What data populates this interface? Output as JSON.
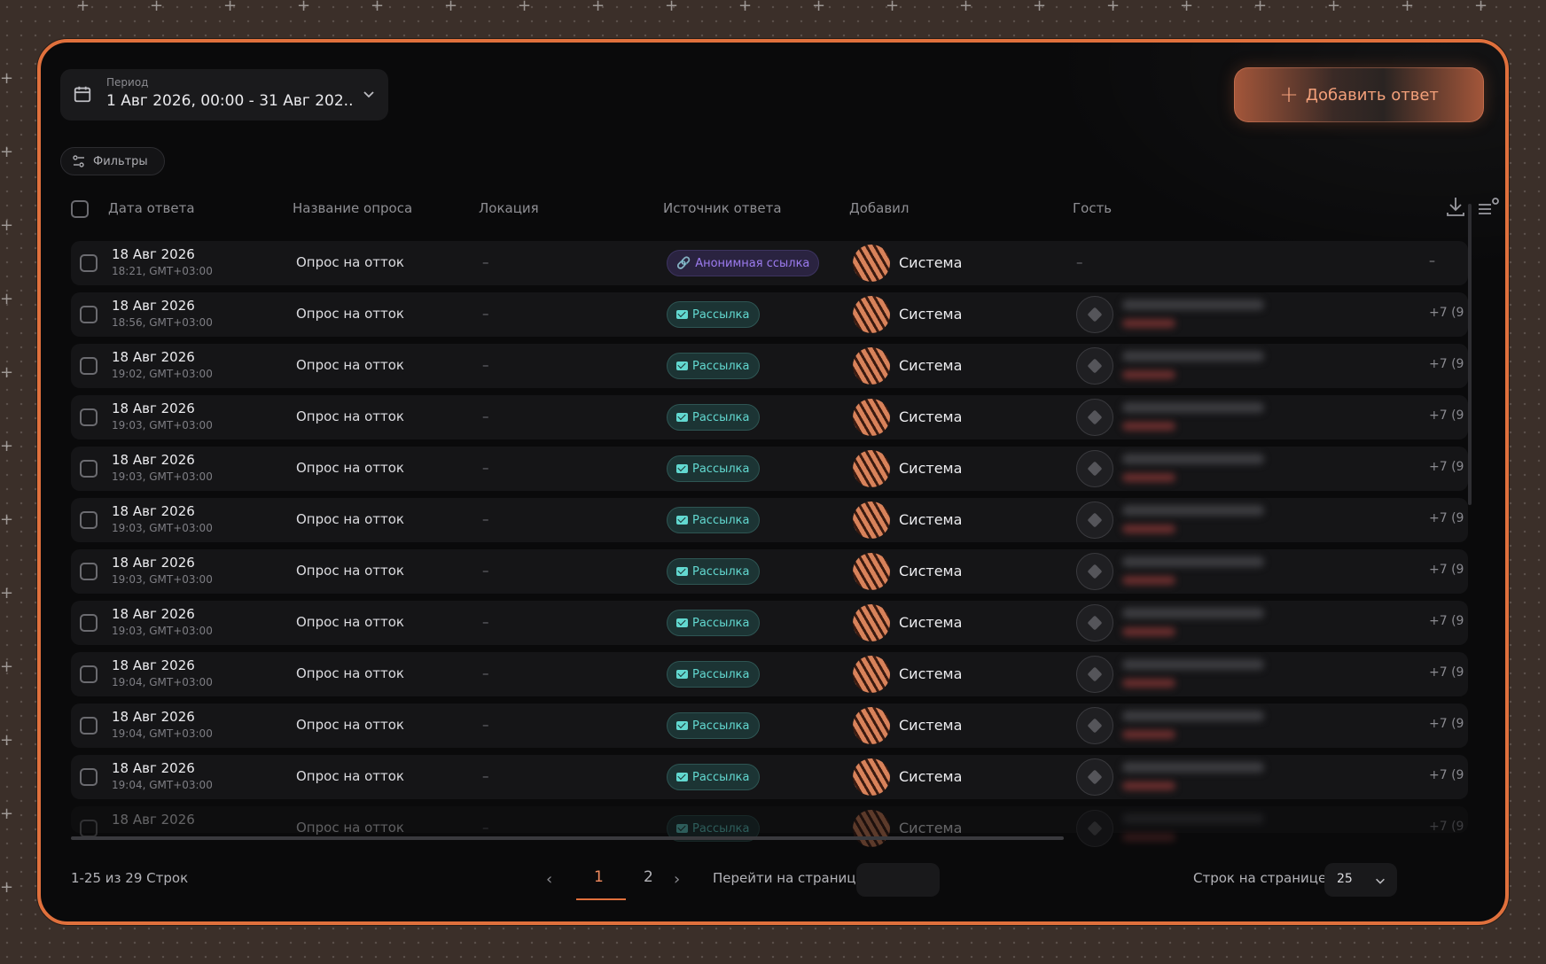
{
  "period": {
    "label": "Период",
    "value": "1 Авг 2026, 00:00 - 31 Авг 202..."
  },
  "add_button": {
    "label": "Добавить ответ"
  },
  "filters": {
    "label": "Фильтры"
  },
  "columns": {
    "date": "Дата ответа",
    "survey": "Название опроса",
    "location": "Локация",
    "source": "Источник ответа",
    "added_by": "Добавил",
    "guest": "Гость"
  },
  "rows": [
    {
      "date": "18 Авг 2026",
      "time": "18:21, GMT+03:00",
      "survey": "Опрос на отток",
      "location": "–",
      "source": "Анонимная ссылка",
      "source_type": "anonymous",
      "added_by": "Система",
      "guest": "–",
      "phone": "–"
    },
    {
      "date": "18 Авг 2026",
      "time": "18:56, GMT+03:00",
      "survey": "Опрос на отток",
      "location": "–",
      "source": "Рассылка",
      "source_type": "mailing",
      "added_by": "Система",
      "guest": "",
      "phone": "+7 (9"
    },
    {
      "date": "18 Авг 2026",
      "time": "19:02, GMT+03:00",
      "survey": "Опрос на отток",
      "location": "–",
      "source": "Рассылка",
      "source_type": "mailing",
      "added_by": "Система",
      "guest": "",
      "phone": "+7 (9"
    },
    {
      "date": "18 Авг 2026",
      "time": "19:03, GMT+03:00",
      "survey": "Опрос на отток",
      "location": "–",
      "source": "Рассылка",
      "source_type": "mailing",
      "added_by": "Система",
      "guest": "",
      "phone": "+7 (9"
    },
    {
      "date": "18 Авг 2026",
      "time": "19:03, GMT+03:00",
      "survey": "Опрос на отток",
      "location": "–",
      "source": "Рассылка",
      "source_type": "mailing",
      "added_by": "Система",
      "guest": "",
      "phone": "+7 (9"
    },
    {
      "date": "18 Авг 2026",
      "time": "19:03, GMT+03:00",
      "survey": "Опрос на отток",
      "location": "–",
      "source": "Рассылка",
      "source_type": "mailing",
      "added_by": "Система",
      "guest": "",
      "phone": "+7 (9"
    },
    {
      "date": "18 Авг 2026",
      "time": "19:03, GMT+03:00",
      "survey": "Опрос на отток",
      "location": "–",
      "source": "Рассылка",
      "source_type": "mailing",
      "added_by": "Система",
      "guest": "",
      "phone": "+7 (9"
    },
    {
      "date": "18 Авг 2026",
      "time": "19:03, GMT+03:00",
      "survey": "Опрос на отток",
      "location": "–",
      "source": "Рассылка",
      "source_type": "mailing",
      "added_by": "Система",
      "guest": "",
      "phone": "+7 (9"
    },
    {
      "date": "18 Авг 2026",
      "time": "19:04, GMT+03:00",
      "survey": "Опрос на отток",
      "location": "–",
      "source": "Рассылка",
      "source_type": "mailing",
      "added_by": "Система",
      "guest": "",
      "phone": "+7 (9"
    },
    {
      "date": "18 Авг 2026",
      "time": "19:04, GMT+03:00",
      "survey": "Опрос на отток",
      "location": "–",
      "source": "Рассылка",
      "source_type": "mailing",
      "added_by": "Система",
      "guest": "",
      "phone": "+7 (9"
    },
    {
      "date": "18 Авг 2026",
      "time": "19:04, GMT+03:00",
      "survey": "Опрос на отток",
      "location": "–",
      "source": "Рассылка",
      "source_type": "mailing",
      "added_by": "Система",
      "guest": "",
      "phone": "+7 (9"
    },
    {
      "date": "18 Авг 2026",
      "time": "",
      "survey": "Опрос на отток",
      "location": "–",
      "source": "Рассылка",
      "source_type": "mailing",
      "added_by": "Система",
      "guest": "",
      "phone": "+7 (9"
    }
  ],
  "pagination": {
    "summary": "1-25  из  29 Строк",
    "pages": [
      "1",
      "2"
    ],
    "current_page": "1",
    "goto_label": "Перейти на страницу",
    "rows_per_page_label": "Строк на странице",
    "rows_per_page_value": "25"
  },
  "colors": {
    "accent": "#e0703c",
    "mailing": "#62d8d0",
    "anonymous": "#9d7cf0"
  }
}
